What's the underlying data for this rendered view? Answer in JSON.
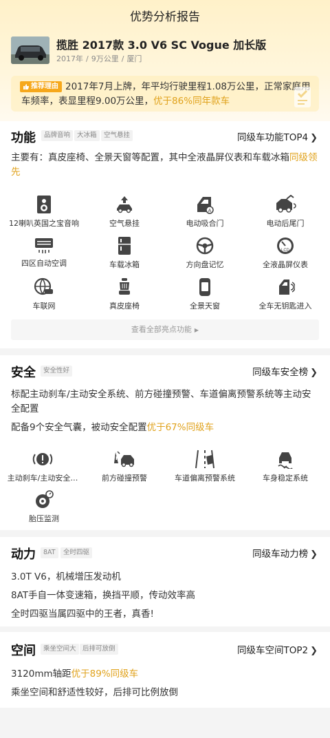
{
  "page_title": "优势分析报告",
  "car": {
    "name": "揽胜 2017款 3.0 V6 SC Vogue 加长版",
    "year": "2017年",
    "mileage": "9万公里",
    "city": "厦门",
    "meta_separator": "/"
  },
  "recommend": {
    "badge": "推荐理由",
    "text": "2017年7月上牌，年平均行驶里程1.08万公里，正常家庭用车频率，表显里程9.00万公里，",
    "highlight": "优于86%同年款车"
  },
  "function": {
    "title": "功能",
    "tags": [
      "品牌音响",
      "大冰箱",
      "空气悬挂"
    ],
    "rank": "同级车功能TOP4",
    "desc": "主要有：真皮座椅、全景天窗等配置，其中全液晶屏仪表和车载冰箱",
    "desc_highlight": "同级领先",
    "features": [
      {
        "label": "12喇叭英国之宝音响",
        "icon": "speaker-icon"
      },
      {
        "label": "空气悬挂",
        "icon": "air-suspension-icon"
      },
      {
        "label": "电动吸合门",
        "icon": "soft-close-door-icon"
      },
      {
        "label": "电动后尾门",
        "icon": "power-tailgate-icon"
      },
      {
        "label": "四区自动空调",
        "icon": "air-conditioner-icon"
      },
      {
        "label": "车载冰箱",
        "icon": "fridge-icon"
      },
      {
        "label": "方向盘记忆",
        "icon": "steering-wheel-icon"
      },
      {
        "label": "全液晶屏仪表",
        "icon": "lcd-gauge-icon"
      },
      {
        "label": "车联网",
        "icon": "connected-car-icon"
      },
      {
        "label": "真皮座椅",
        "icon": "leather-seat-icon"
      },
      {
        "label": "全景天窗",
        "icon": "sunroof-icon"
      },
      {
        "label": "全车无钥匙进入",
        "icon": "keyless-entry-icon"
      }
    ],
    "view_all": "查看全部亮点功能"
  },
  "safety": {
    "title": "安全",
    "tags": [
      "安全性好"
    ],
    "rank": "同级车安全榜",
    "desc1": "标配主动刹车/主动安全系统、前方碰撞预警、车道偏离预警系统等主动安全配置",
    "desc2": "配备9个安全气囊，被动安全配置",
    "desc2_highlight": "优于67%同级车",
    "features": [
      {
        "label": "主动刹车/主动安全…",
        "icon": "brake-alert-icon"
      },
      {
        "label": "前方碰撞预警",
        "icon": "collision-warning-icon"
      },
      {
        "label": "车道偏离预警系统",
        "icon": "lane-departure-icon"
      },
      {
        "label": "车身稳定系统",
        "icon": "stability-control-icon"
      },
      {
        "label": "胎压监测",
        "icon": "tire-pressure-icon"
      }
    ]
  },
  "power": {
    "title": "动力",
    "tags": [
      "8AT",
      "全时四驱"
    ],
    "rank": "同级车动力榜",
    "lines": [
      "3.0T V6，机械增压发动机",
      "8AT手自一体变速箱，换挡平顺，传动效率高",
      "全时四驱当属四驱中的王者，真香!"
    ]
  },
  "space": {
    "title": "空间",
    "tags": [
      "乘坐空间大",
      "后排可放倒"
    ],
    "rank": "同级车空间TOP2",
    "line1": "3120mm轴距",
    "line1_highlight": "优于89%同级车",
    "line2": "乘坐空间和舒适性较好，后排可比例放倒"
  },
  "colors": {
    "accent": "#e0a21c",
    "badge": "#f6a81c",
    "hero": "#fff1c9"
  }
}
